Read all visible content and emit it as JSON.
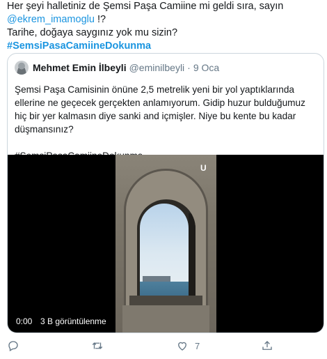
{
  "tweet": {
    "line1": "Her şeyi halletiniz de Şemsi Paşa Camiine mi geldi sıra, sayın",
    "mention": "@ekrem_imamoglu",
    "mention_suffix": " !?",
    "line3": "Tarihe, doğaya saygınız yok mu sizin?",
    "hashtag": "#SemsiPasaCamiineDokunma"
  },
  "quote": {
    "name": "Mehmet Emin İlbeyli",
    "handle": "@eminilbeyli",
    "separator": "·",
    "date": "9 Oca",
    "paragraph": "Şemsi Paşa Camisinin önüne 2,5 metrelik yeni bir yol yaptıklarında ellerine ne geçecek gerçekten anlamıyorum. Gidip huzur bulduğumuz hiç bir yer kalmasın diye sanki and içmişler. Niye bu kente bu kadar düşmansınız?",
    "hashtag": "#SemsiPasaCamiineDokunma"
  },
  "video": {
    "time": "0:00",
    "views": "3 B görüntülenme",
    "corner_mark": "U"
  },
  "actions": {
    "like_count": "7",
    "icons": [
      "reply-icon",
      "retweet-icon",
      "like-icon",
      "share-icon"
    ]
  },
  "colors": {
    "link": "#1b95e0",
    "text": "#14171a",
    "secondary": "#657786",
    "border": "#ccd6dd"
  }
}
